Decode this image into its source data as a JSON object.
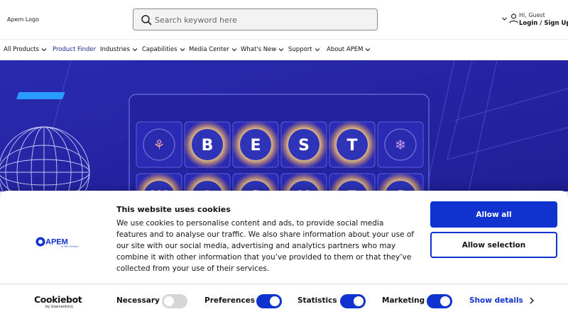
{
  "header": {
    "logo_text": "Apem Logo",
    "search": {
      "placeholder": "Search keyword here",
      "value": ""
    },
    "account": {
      "greeting": "Hi, Guest",
      "login_label": "Login / Sign Up"
    }
  },
  "nav": {
    "items": [
      {
        "label": "All Products",
        "has_dropdown": true
      },
      {
        "label": "Product Finder",
        "has_dropdown": false,
        "active": true
      },
      {
        "label": "Industries",
        "has_dropdown": true
      },
      {
        "label": "Capabilities",
        "has_dropdown": true
      },
      {
        "label": "Media Center",
        "has_dropdown": true
      },
      {
        "label": "What's New",
        "has_dropdown": true
      },
      {
        "label": "Support",
        "has_dropdown": true
      },
      {
        "label": "About APEM",
        "has_dropdown": true
      }
    ]
  },
  "hero": {
    "keypad_row_1": [
      "reindeer-icon",
      "B",
      "E",
      "S",
      "T",
      "snowflake-icon"
    ],
    "keypad_row_2": [
      "W",
      "I",
      "S",
      "H",
      "E",
      "S"
    ]
  },
  "cookie_banner": {
    "title": "This website uses cookies",
    "text": "We use cookies to personalise content and ads, to provide social media features and to analyse our traffic. We also share information about your use of our site with our social media, advertising and analytics partners who may combine it with other information that you’ve provided to them or that they’ve collected from your use of their services.",
    "allow_all_label": "Allow all",
    "allow_selection_label": "Allow selection",
    "brand_logo_text": "APEM",
    "brand_logo_tagline": "an IDEC company",
    "powered_by_name": "Cookiebot",
    "powered_by_sub": "by Usercentrics",
    "toggles": [
      {
        "label": "Necessary",
        "checked": true,
        "disabled": true
      },
      {
        "label": "Preferences",
        "checked": true,
        "disabled": false
      },
      {
        "label": "Statistics",
        "checked": true,
        "disabled": false
      },
      {
        "label": "Marketing",
        "checked": true,
        "disabled": false
      }
    ],
    "show_details_label": "Show details"
  },
  "colors": {
    "accent": "#1032cf",
    "hero_background": "#2525a6",
    "nav_active": "#1c2f8e",
    "toggle_disabled": "#d6d6d6"
  }
}
